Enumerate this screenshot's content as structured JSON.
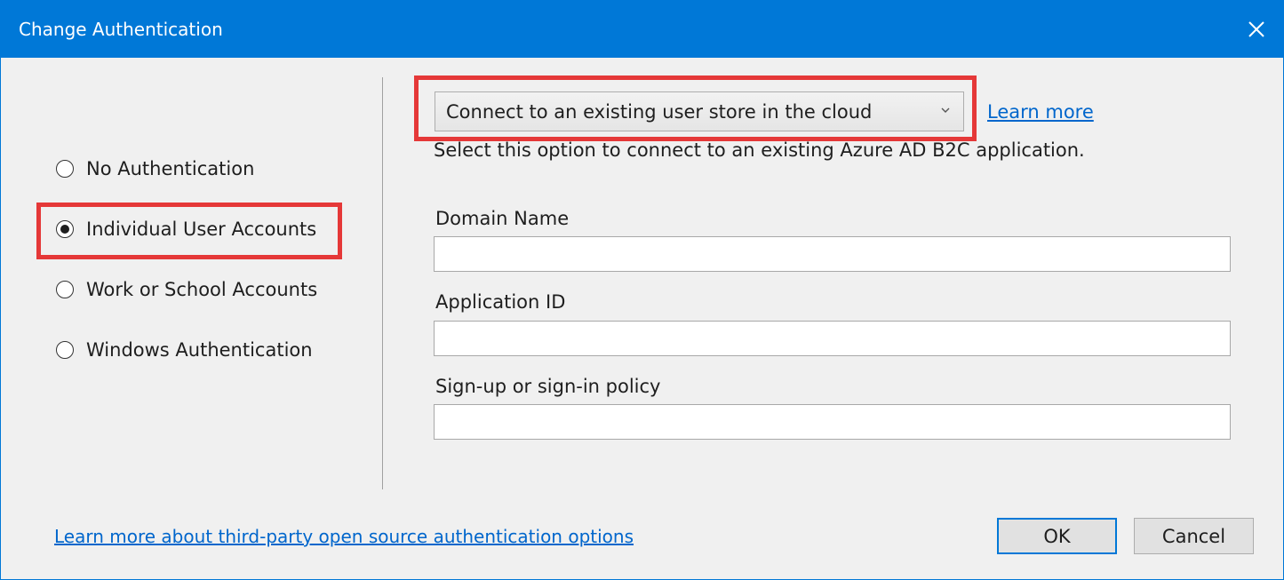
{
  "window": {
    "title": "Change Authentication",
    "close_icon": "close-icon"
  },
  "auth_options": [
    {
      "label": "No Authentication",
      "selected": false
    },
    {
      "label": "Individual User Accounts",
      "selected": true
    },
    {
      "label": "Work or School Accounts",
      "selected": false
    },
    {
      "label": "Windows Authentication",
      "selected": false
    }
  ],
  "store": {
    "selected_option": "Connect to an existing user store in the cloud",
    "learn_more": "Learn more",
    "description": "Select this option to connect to an existing Azure AD B2C application."
  },
  "fields": {
    "domain_name": {
      "label": "Domain Name",
      "value": ""
    },
    "application_id": {
      "label": "Application ID",
      "value": ""
    },
    "policy": {
      "label": "Sign-up or sign-in policy",
      "value": ""
    }
  },
  "footer": {
    "third_party_link": "Learn more about third-party open source authentication options",
    "ok_label": "OK",
    "cancel_label": "Cancel"
  },
  "colors": {
    "accent": "#0078d7",
    "highlight": "#e53838",
    "link": "#0066cc"
  }
}
